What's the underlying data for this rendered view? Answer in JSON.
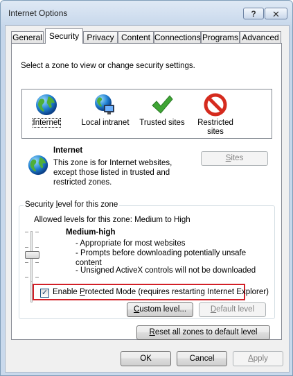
{
  "window": {
    "title": "Internet Options",
    "help_label": "?",
    "close_label": "✕"
  },
  "tabs": [
    {
      "label": "General",
      "active": false
    },
    {
      "label": "Security",
      "active": true
    },
    {
      "label": "Privacy",
      "active": false
    },
    {
      "label": "Content",
      "active": false
    },
    {
      "label": "Connections",
      "active": false
    },
    {
      "label": "Programs",
      "active": false
    },
    {
      "label": "Advanced",
      "active": false
    }
  ],
  "security": {
    "zone_prompt": "Select a zone to view or change security settings.",
    "zones": [
      {
        "label": "Internet",
        "icon": "globe-icon",
        "selected": true
      },
      {
        "label": "Local intranet",
        "icon": "intranet-icon",
        "selected": false
      },
      {
        "label": "Trusted sites",
        "icon": "checkmark-icon",
        "selected": false
      },
      {
        "label_line1": "Restricted",
        "label_line2": "sites",
        "icon": "restricted-icon",
        "selected": false
      }
    ],
    "zone_info": {
      "name": "Internet",
      "desc1": "This zone is for Internet websites,",
      "desc2": "except those listed in trusted and",
      "desc3": "restricted zones."
    },
    "sites_button": {
      "prefix": "",
      "underlined": "S",
      "suffix": "ites",
      "enabled": false
    },
    "level_group": {
      "title_prefix": "Security ",
      "title_underlined": "l",
      "title_suffix": "evel for this zone",
      "allowed": "Allowed levels for this zone: Medium to High",
      "level_name": "Medium-high",
      "bullets": [
        "- Appropriate for most websites",
        "- Prompts before downloading potentially unsafe",
        "content",
        "- Unsigned ActiveX controls will not be downloaded"
      ],
      "slider_level": "Medium-high",
      "protected_mode": {
        "checked": true,
        "prefix": "Enable ",
        "underlined": "P",
        "suffix": "rotected Mode (requires restarting Internet Explorer)"
      },
      "custom_button": {
        "underlined": "C",
        "rest": "ustom level..."
      },
      "default_button": {
        "underlined": "D",
        "rest": "efault level",
        "enabled": false
      }
    },
    "reset_button": {
      "underlined": "R",
      "rest": "eset all zones to default level"
    }
  },
  "dialog_buttons": {
    "ok": "OK",
    "cancel": "Cancel",
    "apply": "Apply",
    "apply_underlined": "A",
    "apply_rest": "pply"
  },
  "colors": {
    "highlight_border": "#d21f27"
  }
}
